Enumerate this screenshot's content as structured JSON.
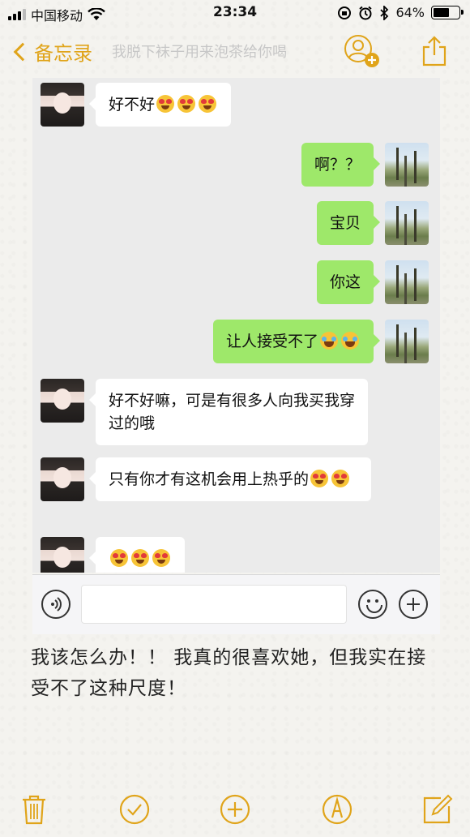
{
  "status_bar": {
    "carrier": "中国移动",
    "time": "23:34",
    "battery": "64%",
    "battery_level": 0.64
  },
  "nav": {
    "back_label": "备忘录",
    "ghost_title": "我脱下袜子用来泡茶给你喝"
  },
  "chat": {
    "messages": [
      {
        "side": "left",
        "text": "好不好",
        "emojis": [
          "heart-eyes",
          "heart-eyes",
          "heart-eyes"
        ]
      },
      {
        "side": "right",
        "text": "啊？？",
        "emojis": []
      },
      {
        "side": "right",
        "text": "宝贝",
        "emojis": []
      },
      {
        "side": "right",
        "text": "你这",
        "emojis": []
      },
      {
        "side": "right",
        "text": "让人接受不了",
        "emojis": [
          "laughing-crying",
          "laughing-crying"
        ]
      },
      {
        "side": "left",
        "text": "好不好嘛，可是有很多人向我买我穿过的哦",
        "emojis": []
      },
      {
        "side": "left",
        "text": "只有你才有这机会用上热乎的",
        "emojis": [
          "heart-eyes",
          "heart-eyes"
        ]
      },
      {
        "side": "left",
        "text": "",
        "emojis": [
          "heart-eyes",
          "heart-eyes",
          "heart-eyes"
        ]
      }
    ]
  },
  "note": {
    "body": "我该怎么办！！ 我真的很喜欢她，但我实在接受不了这种尺度！"
  },
  "colors": {
    "accent": "#e0a41a",
    "sent_bubble": "#9ee86a",
    "received_bubble": "#ffffff",
    "chat_bg": "#ebebeb"
  }
}
